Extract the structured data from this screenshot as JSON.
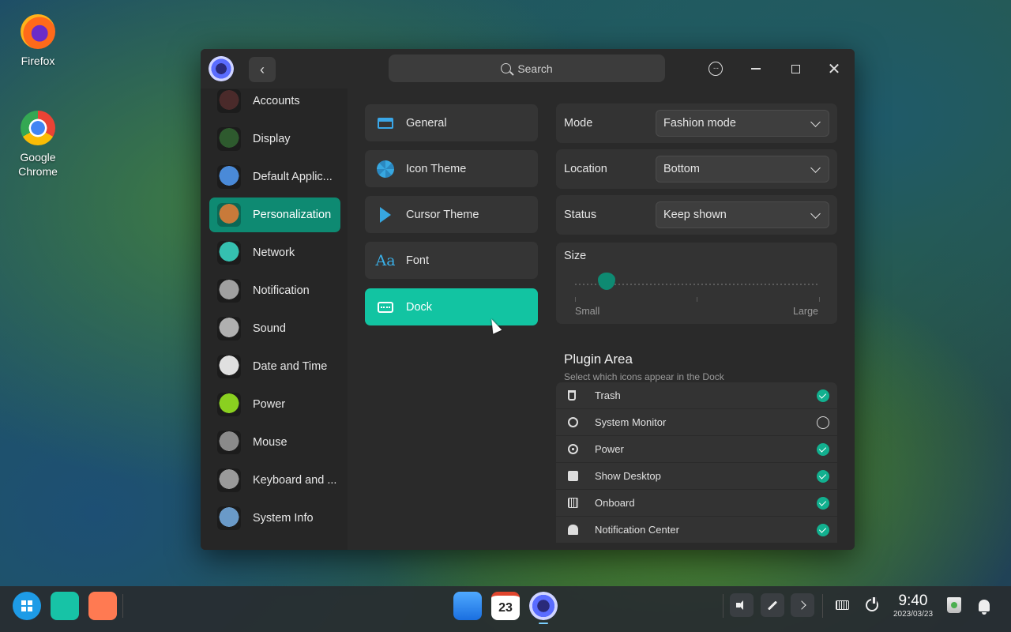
{
  "desktop": {
    "icons": [
      {
        "label": "Firefox"
      },
      {
        "label": "Google Chrome"
      }
    ]
  },
  "window": {
    "search_placeholder": "Search",
    "sidebar": {
      "items": [
        {
          "label": "Accounts",
          "icon": "accounts-icon",
          "color": "#4a2a2a"
        },
        {
          "label": "Display",
          "icon": "display-icon",
          "color": "#2e5a2e"
        },
        {
          "label": "Default Applic...",
          "icon": "default-apps-icon",
          "color": "#4a8ad8"
        },
        {
          "label": "Personalization",
          "icon": "personalization-icon",
          "color": "#c87a3a",
          "active": true
        },
        {
          "label": "Network",
          "icon": "network-icon",
          "color": "#35c0b0"
        },
        {
          "label": "Notification",
          "icon": "notification-icon",
          "color": "#a0a0a0"
        },
        {
          "label": "Sound",
          "icon": "sound-icon",
          "color": "#b0b0b0"
        },
        {
          "label": "Date and Time",
          "icon": "clock-icon",
          "color": "#e0e0e0"
        },
        {
          "label": "Power",
          "icon": "battery-icon",
          "color": "#8ad020"
        },
        {
          "label": "Mouse",
          "icon": "mouse-icon",
          "color": "#8a8a8a"
        },
        {
          "label": "Keyboard and ...",
          "icon": "keyboard-icon",
          "color": "#9a9a9a"
        },
        {
          "label": "System Info",
          "icon": "system-info-icon",
          "color": "#6a9ac8"
        }
      ]
    },
    "subnav": {
      "items": [
        {
          "label": "General",
          "icon": "general-icon"
        },
        {
          "label": "Icon Theme",
          "icon": "icon-theme-icon"
        },
        {
          "label": "Cursor Theme",
          "icon": "cursor-theme-icon"
        },
        {
          "label": "Font",
          "icon": "font-icon",
          "glyph": "Aa"
        },
        {
          "label": "Dock",
          "icon": "dock-icon",
          "active": true
        }
      ]
    },
    "dock_settings": {
      "mode": {
        "label": "Mode",
        "value": "Fashion mode"
      },
      "location": {
        "label": "Location",
        "value": "Bottom"
      },
      "status": {
        "label": "Status",
        "value": "Keep shown"
      },
      "size": {
        "label": "Size",
        "min_label": "Small",
        "max_label": "Large",
        "value_fraction": 0.13
      },
      "plugin_area": {
        "title": "Plugin Area",
        "subtitle": "Select which icons appear in the Dock",
        "plugins": [
          {
            "label": "Trash",
            "icon": "trash-icon",
            "checked": true
          },
          {
            "label": "System Monitor",
            "icon": "system-monitor-icon",
            "checked": false
          },
          {
            "label": "Power",
            "icon": "power-icon",
            "checked": true
          },
          {
            "label": "Show Desktop",
            "icon": "show-desktop-icon",
            "checked": true
          },
          {
            "label": "Onboard",
            "icon": "onboard-keyboard-icon",
            "checked": true
          },
          {
            "label": "Notification Center",
            "icon": "notification-bell-icon",
            "checked": true
          }
        ]
      }
    }
  },
  "taskbar": {
    "calendar_day": "23",
    "clock": {
      "time": "9:40",
      "date": "2023/03/23"
    }
  },
  "colors": {
    "accent": "#12c4a2",
    "accent_dark": "#0e8a72",
    "window_bg": "#2a2a2a"
  }
}
